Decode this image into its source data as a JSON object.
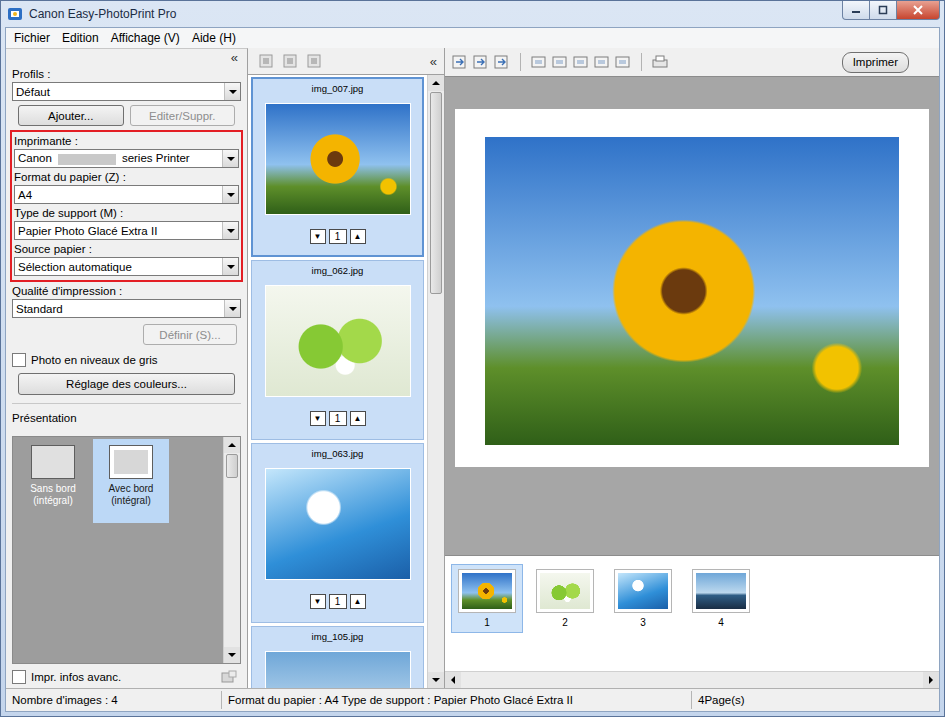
{
  "window": {
    "title": "Canon Easy-PhotoPrint Pro"
  },
  "menu": [
    "Fichier",
    "Edition",
    "Affichage (V)",
    "Aide (H)"
  ],
  "settings": {
    "collapse": "«",
    "profiles": {
      "label": "Profils :",
      "value": "Défaut"
    },
    "profile_buttons": [
      {
        "label": "Ajouter...",
        "disabled": false
      },
      {
        "label": "Editer/Suppr.",
        "disabled": true
      }
    ],
    "highlighted_fields": [
      {
        "label": "Imprimante :",
        "value": "Canon",
        "redacted": true,
        "suffix": "series Printer"
      },
      {
        "label": "Format du papier (Z) :",
        "value": "A4",
        "redacted": false
      },
      {
        "label": "Type de support (M) :",
        "value": "Papier Photo Glacé Extra II",
        "redacted": false
      },
      {
        "label": "Source papier :",
        "value": "Sélection automatique",
        "redacted": false
      }
    ],
    "quality": {
      "label": "Qualité d'impression :",
      "value": "Standard"
    },
    "define_button": {
      "label": "Définir (S)...",
      "disabled": true
    },
    "grayscale": {
      "label": "Photo en niveaux de gris",
      "checked": false
    },
    "color_button": {
      "label": "Réglage des couleurs..."
    },
    "layout": {
      "label": "Présentation",
      "items": [
        {
          "label": "Sans bord",
          "sub": "(intégral)",
          "kind": "borderless",
          "selected": false
        },
        {
          "label": "Avec bord",
          "sub": "(intégral)",
          "kind": "bordered",
          "selected": true
        }
      ]
    },
    "advanced_info": {
      "label": "Impr. infos avanc.",
      "checked": false
    }
  },
  "thumbnails": {
    "collapse": "«",
    "down": "▼",
    "up": "▲",
    "items": [
      {
        "name": "img_007.jpg",
        "copies": "1",
        "selected": true
      },
      {
        "name": "img_062.jpg",
        "copies": "1",
        "selected": false
      },
      {
        "name": "img_063.jpg",
        "copies": "1",
        "selected": false
      },
      {
        "name": "img_105.jpg",
        "selected": false
      }
    ]
  },
  "preview": {
    "print_button": "Imprimer",
    "pages": [
      {
        "number": "1",
        "selected": true
      },
      {
        "number": "2",
        "selected": false
      },
      {
        "number": "3",
        "selected": false
      },
      {
        "number": "4",
        "selected": false
      }
    ]
  },
  "status_bar": [
    "Nombre d'images : 4",
    "Format du papier : A4 Type de support : Papier Photo Glacé Extra II",
    "4Page(s)"
  ]
}
